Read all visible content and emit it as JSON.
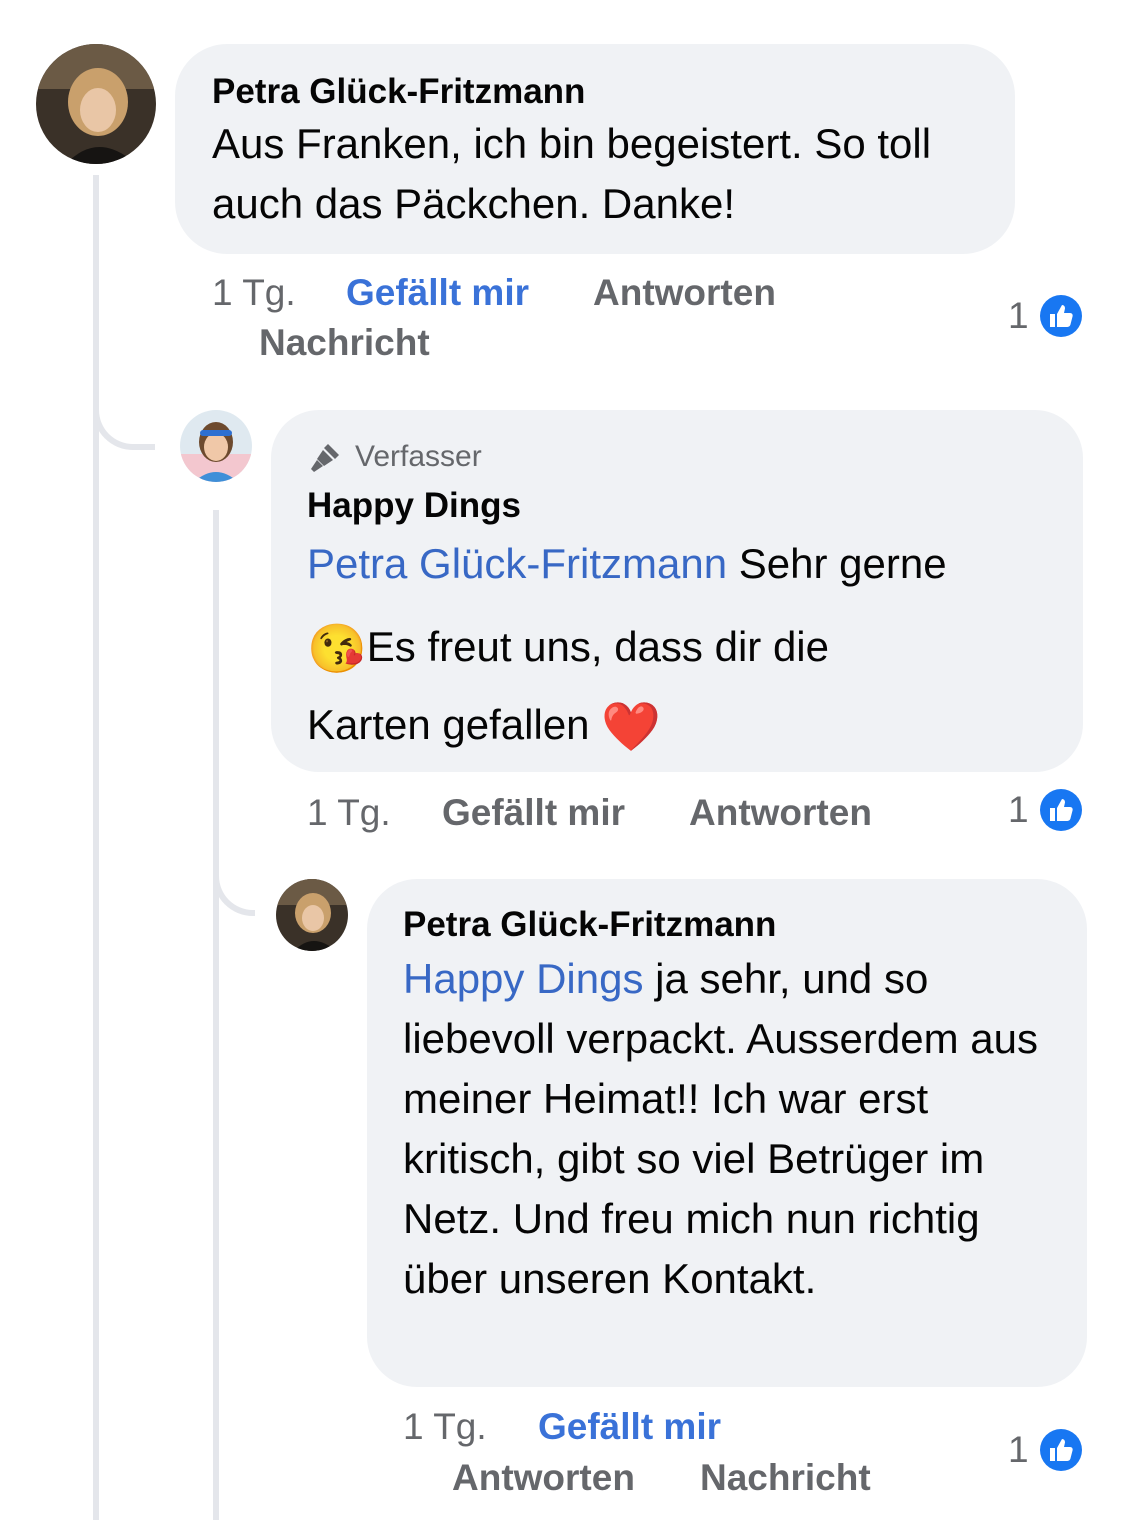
{
  "colors": {
    "bubble_bg": "#f0f2f5",
    "mention": "#3868c5",
    "like_active": "#3a72d8",
    "meta_gray": "#65676b",
    "thread_line": "#e4e6eb",
    "like_badge": "#1877f2"
  },
  "comments": [
    {
      "author": "Petra Glück-Fritzmann",
      "text": "Aus Franken, ich bin begeistert.  So toll auch das Päckchen.  Danke!",
      "time": "1 Tg.",
      "like_label": "Gefällt mir",
      "reply_label": "Antworten",
      "message_label": "Nachricht",
      "reaction_count": "1",
      "reaction_icon": "thumbs-up-icon"
    },
    {
      "badge": "Verfasser",
      "badge_icon": "microphone-icon",
      "author": "Happy Dings",
      "mention": "Petra Glück-Fritzmann",
      "text_part1": " Sehr gerne",
      "emoji1": "😘",
      "text_part2": "Es freut uns, dass dir die",
      "text_part3": "Karten gefallen ",
      "emoji2": "❤️",
      "time": "1 Tg.",
      "like_label": "Gefällt mir",
      "reply_label": "Antworten",
      "reaction_count": "1",
      "reaction_icon": "thumbs-up-icon"
    },
    {
      "author": "Petra Glück-Fritzmann",
      "mention": "Happy Dings",
      "text": " ja sehr, und so liebevoll verpackt. Ausserdem aus meiner Heimat!! Ich war erst kritisch,  gibt so viel Betrüger im Netz. Und freu mich nun richtig über unseren Kontakt.",
      "time": "1 Tg.",
      "like_label": "Gefällt mir",
      "reply_label": "Antworten",
      "message_label": "Nachricht",
      "reaction_count": "1",
      "reaction_icon": "thumbs-up-icon"
    }
  ]
}
